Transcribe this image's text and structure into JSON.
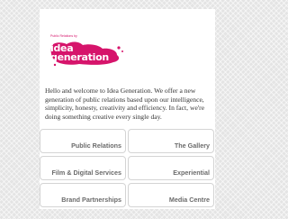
{
  "brand": {
    "tagline": "Public Relations by",
    "logo_line1": "idea",
    "logo_line2": "generation",
    "accent_color": "#d6146b"
  },
  "intro": {
    "text": "Hello and welcome to Idea Generation. We offer a new generation of public relations based upon our intelligence, simplicity, honesty, creativity and efficiency. In fact, we're doing something creative every single day."
  },
  "nav": {
    "items": [
      {
        "label": "Public Relations"
      },
      {
        "label": "The Gallery"
      },
      {
        "label": "Film & Digital Services"
      },
      {
        "label": "Experiential"
      },
      {
        "label": "Brand Partnerships"
      },
      {
        "label": "Media Centre"
      }
    ]
  }
}
